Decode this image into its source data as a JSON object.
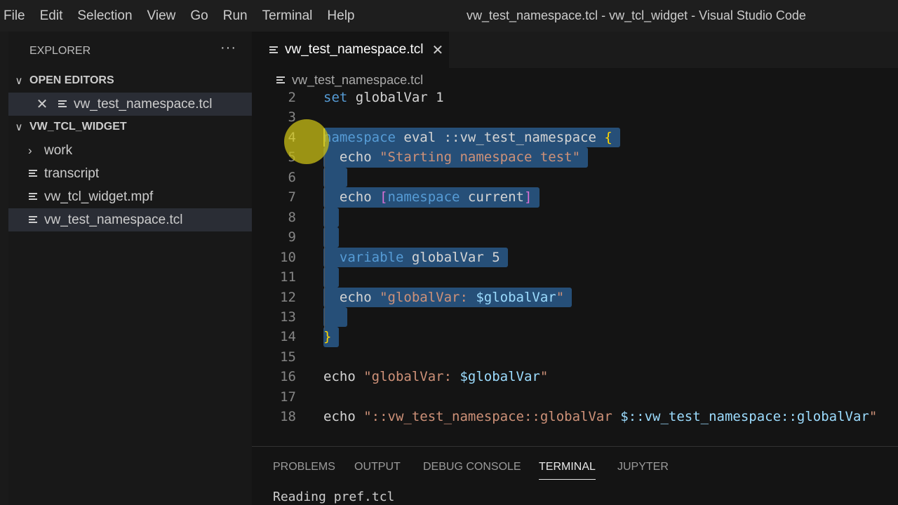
{
  "menu": [
    "File",
    "Edit",
    "Selection",
    "View",
    "Go",
    "Run",
    "Terminal",
    "Help"
  ],
  "window_title": "vw_test_namespace.tcl - vw_tcl_widget - Visual Studio Code",
  "sidebar": {
    "title": "EXPLORER",
    "more_icon": "···",
    "open_editors_label": "OPEN EDITORS",
    "open_editors": [
      {
        "label": "vw_test_namespace.tcl"
      }
    ],
    "project_label": "VW_TCL_WIDGET",
    "items": [
      {
        "label": "work",
        "type": "folder"
      },
      {
        "label": "transcript",
        "type": "file"
      },
      {
        "label": "vw_tcl_widget.mpf",
        "type": "file"
      },
      {
        "label": "vw_test_namespace.tcl",
        "type": "file",
        "active": true
      }
    ]
  },
  "tabs": [
    {
      "label": "vw_test_namespace.tcl",
      "active": true
    }
  ],
  "breadcrumb": "vw_test_namespace.tcl",
  "editor": {
    "current_line": 4,
    "lines": [
      {
        "n": "2",
        "tokens": [
          [
            "set",
            "kw"
          ],
          [
            " globalVar 1",
            "text"
          ]
        ]
      },
      {
        "n": "3",
        "tokens": []
      },
      {
        "n": "4",
        "sel": true,
        "tokens": [
          [
            "namespace",
            "kw"
          ],
          [
            " eval ::vw_test_namespace ",
            "text"
          ],
          [
            "{",
            "brace"
          ]
        ]
      },
      {
        "n": "5",
        "sel": true,
        "tokens": [
          [
            "  echo ",
            "text"
          ],
          [
            "\"Starting namespace test\"",
            "str"
          ]
        ]
      },
      {
        "n": "6",
        "sel": true,
        "tokens": [
          [
            "  ",
            "text"
          ]
        ]
      },
      {
        "n": "7",
        "sel": true,
        "tokens": [
          [
            "  echo ",
            "text"
          ],
          [
            "[",
            "bracket"
          ],
          [
            "namespace",
            "kw"
          ],
          [
            " current",
            "text"
          ],
          [
            "]",
            "bracket"
          ]
        ]
      },
      {
        "n": "8",
        "sel": true,
        "tokens": [
          [
            " ",
            "text"
          ]
        ]
      },
      {
        "n": "9",
        "sel": true,
        "tokens": [
          [
            " ",
            "text"
          ]
        ]
      },
      {
        "n": "10",
        "sel": true,
        "tokens": [
          [
            "  ",
            "text"
          ],
          [
            "variable",
            "kw"
          ],
          [
            " globalVar 5",
            "text"
          ]
        ]
      },
      {
        "n": "11",
        "sel": true,
        "tokens": [
          [
            " ",
            "text"
          ]
        ]
      },
      {
        "n": "12",
        "sel": true,
        "tokens": [
          [
            "  echo ",
            "text"
          ],
          [
            "\"globalVar: ",
            "str"
          ],
          [
            "$globalVar",
            "var"
          ],
          [
            "\"",
            "str"
          ]
        ]
      },
      {
        "n": "13",
        "sel": true,
        "tokens": [
          [
            "  ",
            "text"
          ]
        ]
      },
      {
        "n": "14",
        "sel": true,
        "tokens": [
          [
            "}",
            "brace"
          ]
        ]
      },
      {
        "n": "15",
        "tokens": []
      },
      {
        "n": "16",
        "tokens": [
          [
            "echo ",
            "text"
          ],
          [
            "\"globalVar: ",
            "str"
          ],
          [
            "$globalVar",
            "var"
          ],
          [
            "\"",
            "str"
          ]
        ]
      },
      {
        "n": "17",
        "tokens": []
      },
      {
        "n": "18",
        "tokens": [
          [
            "echo ",
            "text"
          ],
          [
            "\"::vw_test_namespace::globalVar ",
            "str"
          ],
          [
            "$::vw_test_namespace::globalVar",
            "var"
          ],
          [
            "\"",
            "str"
          ]
        ]
      }
    ]
  },
  "panel": {
    "tabs": [
      {
        "label": "PROBLEMS"
      },
      {
        "label": "OUTPUT"
      },
      {
        "label": "DEBUG CONSOLE"
      },
      {
        "label": "TERMINAL",
        "active": true
      },
      {
        "label": "JUPYTER"
      }
    ],
    "terminal_output": "Reading pref.tcl"
  },
  "colors": {
    "selection": "#264f78",
    "keyword": "#569cd6",
    "string": "#ce9178",
    "variable": "#9cdcfe",
    "brace": "#ffd700",
    "bracket": "#da70d6",
    "click_indicator": "#c8be14"
  }
}
